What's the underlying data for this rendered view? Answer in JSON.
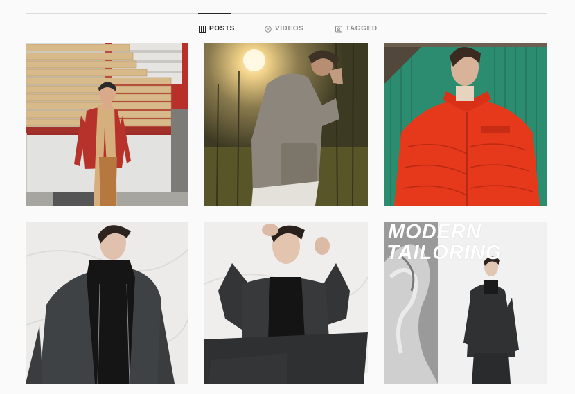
{
  "tabs": [
    {
      "label": "POSTS",
      "icon": "grid-icon",
      "active": true
    },
    {
      "label": "VIDEOS",
      "icon": "play-circle-icon",
      "active": false
    },
    {
      "label": "TAGGED",
      "icon": "tag-portrait-icon",
      "active": false
    }
  ],
  "posts": [
    {
      "id": "post-1"
    },
    {
      "id": "post-2"
    },
    {
      "id": "post-3"
    },
    {
      "id": "post-4"
    },
    {
      "id": "post-5"
    },
    {
      "id": "post-6",
      "overlay_line1": "MODERN",
      "overlay_line2": "TAILORING"
    }
  ],
  "colors": {
    "background": "#fafafa",
    "active_tab": "#262626",
    "inactive_tab": "#8e8e8e",
    "divider": "#dbdbdb"
  }
}
